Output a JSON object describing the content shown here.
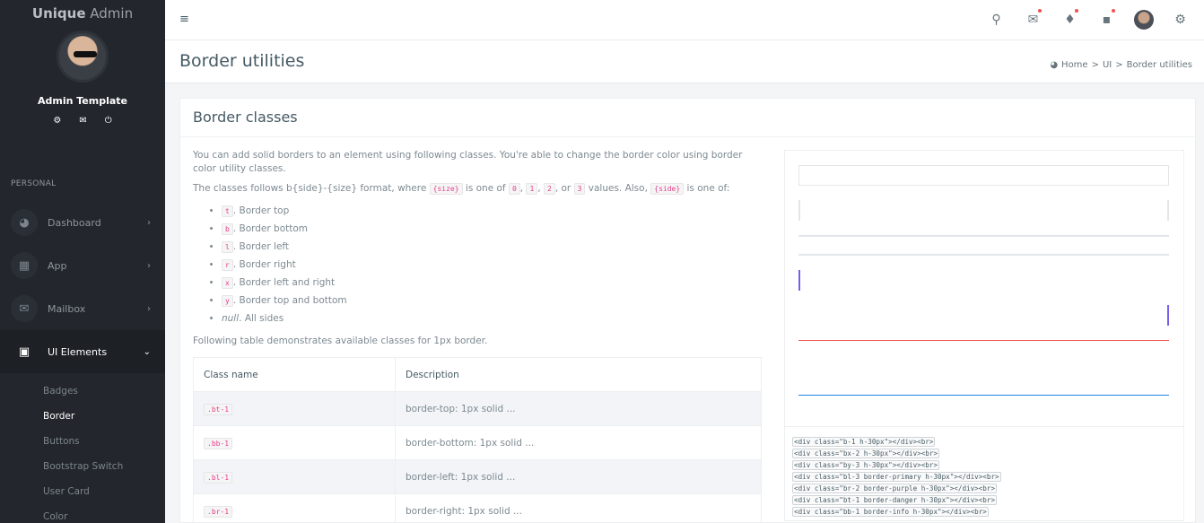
{
  "sidebar": {
    "brand_bold": "Unique",
    "brand_rest": " Admin",
    "user_name": "Admin Template",
    "section_label": "PERSONAL",
    "items": [
      {
        "label": "Dashboard",
        "icon": "dashboard-icon"
      },
      {
        "label": "App",
        "icon": "apps-grid-icon"
      },
      {
        "label": "Mailbox",
        "icon": "mail-icon"
      },
      {
        "label": "UI Elements",
        "icon": "laptop-icon"
      }
    ],
    "sub_items": [
      "Badges",
      "Border",
      "Buttons",
      "Bootstrap Switch",
      "User Card",
      "Color"
    ]
  },
  "topbar": {
    "icons": [
      "search-icon",
      "mail-icon",
      "bell-icon",
      "chat-icon",
      "avatar",
      "gear-icon"
    ]
  },
  "page": {
    "title": "Border utilities",
    "breadcrumb": [
      "Home",
      "UI",
      "Border utilities"
    ]
  },
  "card": {
    "title": "Border classes",
    "intro": "You can add solid borders to an element using following classes. You're able to change the border color using border color utility classes.",
    "format_prefix": "The classes follows b{side}-{size} format, where ",
    "size_code": "{size}",
    "format_mid": " is one of ",
    "sizes": [
      "0",
      "1",
      "2",
      "3"
    ],
    "or": ", or ",
    "values_also": " values. Also, ",
    "side_code": "{side}",
    "is_one_of": " is one of:",
    "sides": [
      {
        "code": "t",
        "text": ". Border top"
      },
      {
        "code": "b",
        "text": ". Border bottom"
      },
      {
        "code": "l",
        "text": ". Border left"
      },
      {
        "code": "r",
        "text": ". Border right"
      },
      {
        "code": "x",
        "text": ". Border left and right"
      },
      {
        "code": "y",
        "text": ". Border top and bottom"
      }
    ],
    "null_label": "null",
    "null_text": ". All sides",
    "table_intro": "Following table demonstrates available classes for 1px border.",
    "table": {
      "headers": [
        "Class name",
        "Description"
      ],
      "rows": [
        {
          "class": ".bt-1",
          "desc": "border-top: 1px solid ..."
        },
        {
          "class": ".bb-1",
          "desc": "border-bottom: 1px solid ..."
        },
        {
          "class": ".bl-1",
          "desc": "border-left: 1px solid ..."
        },
        {
          "class": ".br-1",
          "desc": "border-right: 1px solid ..."
        }
      ]
    },
    "code_lines": [
      "<div class=\"b-1 h-30px\"></div><br>",
      "<div class=\"bx-2 h-30px\"></div><br>",
      "<div class=\"by-3 h-30px\"></div><br>",
      "<div class=\"bl-3 border-primary h-30px\"></div><br>",
      "<div class=\"br-2 border-purple h-30px\"></div><br>",
      "<div class=\"bt-1 border-danger h-30px\"></div><br>",
      "<div class=\"bb-1 border-info h-30px\"></div><br>"
    ]
  },
  "colors": {
    "primary": "#7460ee",
    "purple": "#7460ee",
    "danger": "#ef5350",
    "info": "#1e88e5",
    "neutral_border": "#e3e6e9"
  }
}
